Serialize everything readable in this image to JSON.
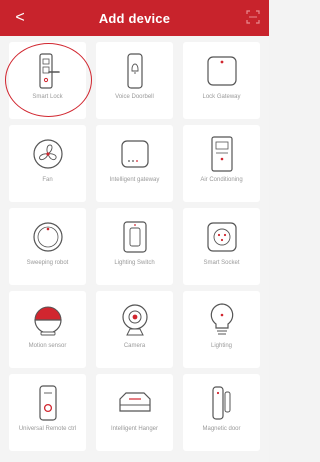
{
  "header": {
    "title": "Add device",
    "back_glyph": "<",
    "back_icon": "chevron-left-icon",
    "scan_icon": "scan-icon"
  },
  "colors": {
    "header_bg": "#c8232c",
    "accent": "#d1262f",
    "tile_bg": "#ffffff",
    "label": "#9a9a9a"
  },
  "devices": [
    {
      "label": "Smart Lock",
      "icon": "door-lock-icon"
    },
    {
      "label": "Voice Doorbell",
      "icon": "doorbell-icon"
    },
    {
      "label": "Lock Gateway",
      "icon": "lock-gateway-icon"
    },
    {
      "label": "Fan",
      "icon": "fan-icon"
    },
    {
      "label": "Intelligent gateway",
      "icon": "intelligent-gateway-icon"
    },
    {
      "label": "Air Conditioning",
      "icon": "air-conditioner-icon"
    },
    {
      "label": "Sweeping robot",
      "icon": "robot-vacuum-icon"
    },
    {
      "label": "Lighting Switch",
      "icon": "light-switch-icon"
    },
    {
      "label": "Smart Socket",
      "icon": "smart-socket-icon"
    },
    {
      "label": "Motion sensor",
      "icon": "motion-sensor-icon"
    },
    {
      "label": "Camera",
      "icon": "camera-icon"
    },
    {
      "label": "Lighting",
      "icon": "light-bulb-icon"
    },
    {
      "label": "Universal Remote ctrl",
      "icon": "universal-remote-icon"
    },
    {
      "label": "Intelligent Hanger",
      "icon": "intelligent-hanger-icon"
    },
    {
      "label": "Magnetic door",
      "icon": "door-sensor-icon"
    }
  ],
  "highlighted_device": "Smart Lock"
}
